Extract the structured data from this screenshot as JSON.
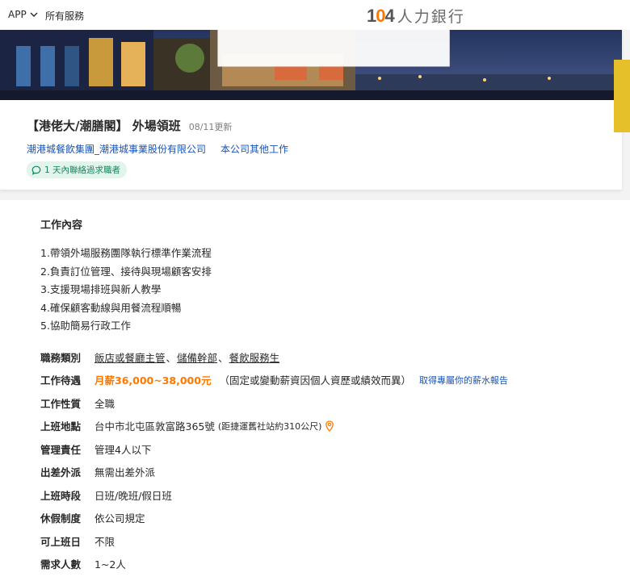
{
  "topbar": {
    "app_label": "APP",
    "all_services_label": "所有服務",
    "logo_number_prefix": "1",
    "logo_number_zero": "0",
    "logo_number_suffix": "4",
    "logo_text": "人力銀行"
  },
  "header": {
    "job_title": "【港佬大/潮膳閣】 外場領班",
    "update_date": "08/11更新",
    "company_name": "潮港城餐飲集團_潮港城事業股份有限公司",
    "other_jobs_link": "本公司其他工作",
    "contact_badge": "1 天內聯絡過求職者"
  },
  "content": {
    "section_title": "工作內容",
    "description_items": [
      "1.帶領外場服務團隊執行標準作業流程",
      "2.負責訂位管理、接待與現場顧客安排",
      "3.支援現場排班與新人教學",
      "4.確保顧客動線與用餐流程順暢",
      "5.協助簡易行政工作"
    ],
    "info": {
      "category_label": "職務類別",
      "categories": [
        "飯店或餐廳主管",
        "儲備幹部",
        "餐飲服務生"
      ],
      "category_separator": "、",
      "salary_label": "工作待遇",
      "salary_value": "月薪36,000~38,000元",
      "salary_note": "（固定或變動薪資因個人資歷或績效而異）",
      "salary_report_link": "取得專屬你的薪水報告",
      "job_type_label": "工作性質",
      "job_type_value": "全職",
      "location_label": "上班地點",
      "location_value": "台中市北屯區敦富路365號",
      "location_note": "(距捷運舊社站約310公尺)",
      "management_label": "管理責任",
      "management_value": "管理4人以下",
      "travel_label": "出差外派",
      "travel_value": "無需出差外派",
      "shift_label": "上班時段",
      "shift_value": "日班/晚班/假日班",
      "vacation_label": "休假制度",
      "vacation_value": "依公司規定",
      "start_label": "可上班日",
      "start_value": "不限",
      "headcount_label": "需求人數",
      "headcount_value": "1~2人"
    }
  },
  "colors": {
    "brand_orange": "#ff7800",
    "link_blue": "#1654b9",
    "badge_green": "#13855b",
    "badge_bg": "#e3f4ec"
  }
}
